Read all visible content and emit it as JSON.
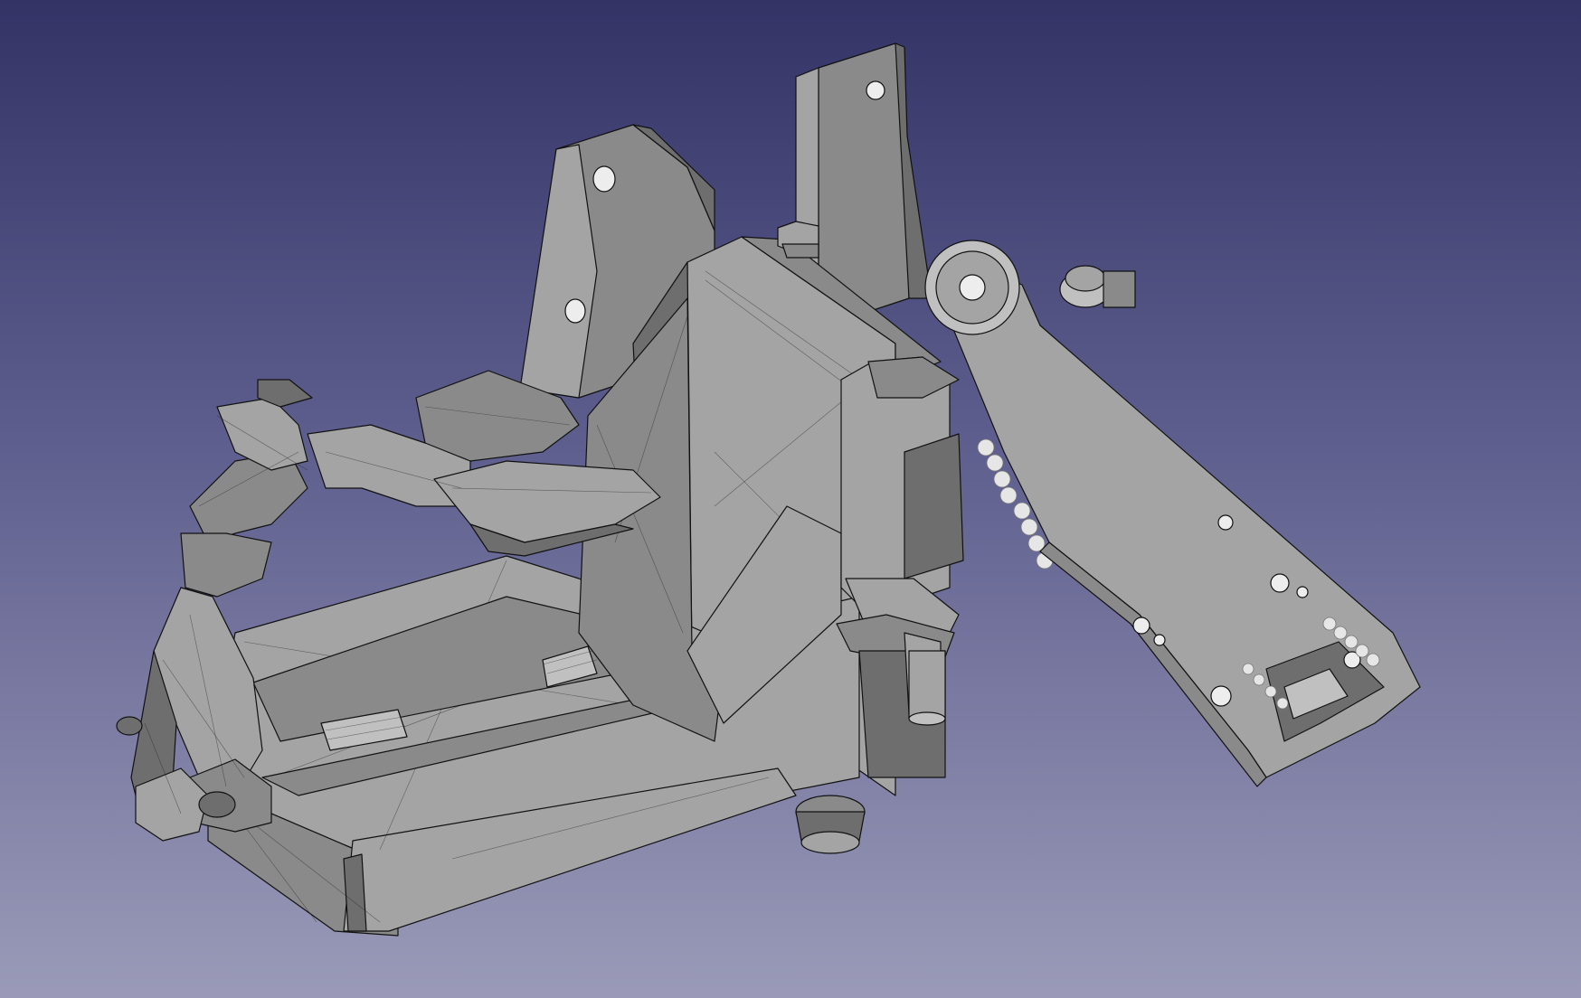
{
  "viewport": {
    "background_top": "#333366",
    "background_bottom": "#9a9ab8"
  },
  "model": {
    "icon": "3d-mesh-model",
    "shade_light": "#a4a4a4",
    "shade_mid": "#8a8a8a",
    "shade_dark": "#6e6e6e",
    "edge_color": "#111111"
  }
}
